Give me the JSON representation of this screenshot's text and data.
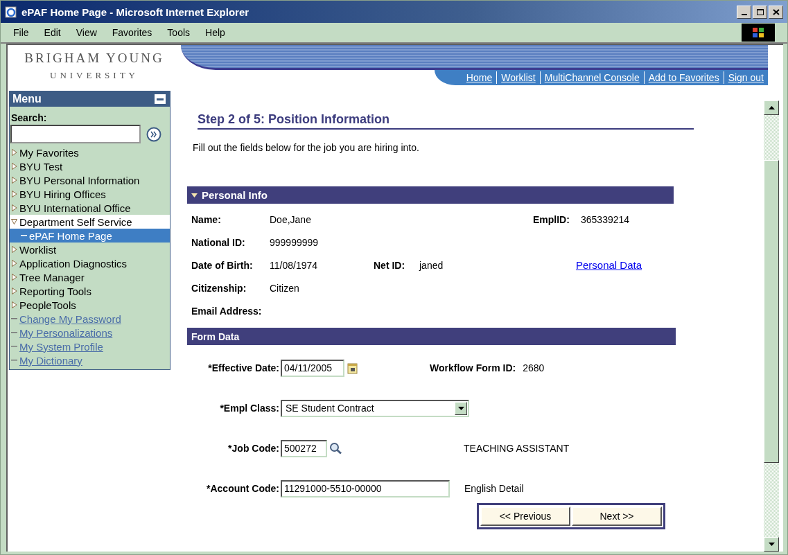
{
  "window": {
    "title": "ePAF Home Page - Microsoft Internet Explorer"
  },
  "menu_bar": [
    "File",
    "Edit",
    "View",
    "Favorites",
    "Tools",
    "Help"
  ],
  "header": {
    "logo_lines": [
      "BRIGHAM YOUNG",
      "UNIVERSITY"
    ],
    "nav_links": [
      "Home",
      "Worklist",
      "MultiChannel Console",
      "Add to Favorites",
      "Sign out"
    ]
  },
  "sidebar": {
    "title": "Menu",
    "search_label": "Search:",
    "items": [
      {
        "label": "My Favorites",
        "kind": "folder",
        "expanded": false,
        "selected": false
      },
      {
        "label": "BYU Test",
        "kind": "folder",
        "expanded": false,
        "selected": false
      },
      {
        "label": "BYU Personal Information",
        "kind": "folder",
        "expanded": false,
        "selected": false
      },
      {
        "label": "BYU Hiring Offices",
        "kind": "folder",
        "expanded": false,
        "selected": false
      },
      {
        "label": "BYU International Office",
        "kind": "folder",
        "expanded": false,
        "selected": false
      },
      {
        "label": "Department Self Service",
        "kind": "folder",
        "expanded": true,
        "selected": false,
        "children": [
          {
            "label": "ePAF Home Page",
            "kind": "page",
            "selected": true
          }
        ]
      },
      {
        "label": "Worklist",
        "kind": "folder",
        "expanded": false,
        "selected": false
      },
      {
        "label": "Application Diagnostics",
        "kind": "folder",
        "expanded": false,
        "selected": false
      },
      {
        "label": "Tree Manager",
        "kind": "folder",
        "expanded": false,
        "selected": false
      },
      {
        "label": "Reporting Tools",
        "kind": "folder",
        "expanded": false,
        "selected": false
      },
      {
        "label": "PeopleTools",
        "kind": "folder",
        "expanded": false,
        "selected": false
      },
      {
        "label": "Change My Password",
        "kind": "link",
        "selected": false
      },
      {
        "label": "My Personalizations",
        "kind": "link",
        "selected": false
      },
      {
        "label": "My System Profile",
        "kind": "link",
        "selected": false
      },
      {
        "label": "My Dictionary",
        "kind": "link",
        "selected": false
      }
    ]
  },
  "content": {
    "title": "Step 2 of 5: Position Information",
    "instructions": "Fill out the fields below for the job you are hiring into.",
    "personal_info": {
      "title": "Personal Info",
      "expanded": true,
      "rows": [
        {
          "left": {
            "label": "Name:",
            "value": "Doe,Jane"
          },
          "right": {
            "kind": "field",
            "label": "EmplID:",
            "value": "365339214"
          }
        },
        {
          "left": {
            "label": "National ID:",
            "value": "999999999"
          }
        },
        {
          "left": {
            "label": "Date of Birth:",
            "value": "11/08/1974"
          },
          "middle": {
            "label": "Net ID:",
            "value": "janed"
          },
          "right": {
            "kind": "link",
            "text": "Personal Data"
          }
        },
        {
          "left": {
            "label": "Citizenship:",
            "value": "Citizen"
          }
        },
        {
          "left": {
            "label": "Email Address:"
          }
        }
      ]
    },
    "form_data": {
      "title": "Form Data",
      "fields": [
        {
          "kind": "date",
          "label": "*Effective Date:",
          "value": "04/11/2005",
          "aside": {
            "label": "Workflow Form ID:",
            "value": "2680"
          }
        },
        {
          "kind": "select",
          "label": "*Empl Class:",
          "value": "SE Student Contract"
        },
        {
          "kind": "lookup",
          "label": "*Job Code:",
          "value": "500272",
          "description": "TEACHING ASSISTANT"
        },
        {
          "kind": "text",
          "label": "*Account Code:",
          "value": "11291000-5510-00000",
          "description": "English Detail"
        }
      ]
    },
    "buttons": [
      "<< Previous",
      "Next >>"
    ]
  }
}
